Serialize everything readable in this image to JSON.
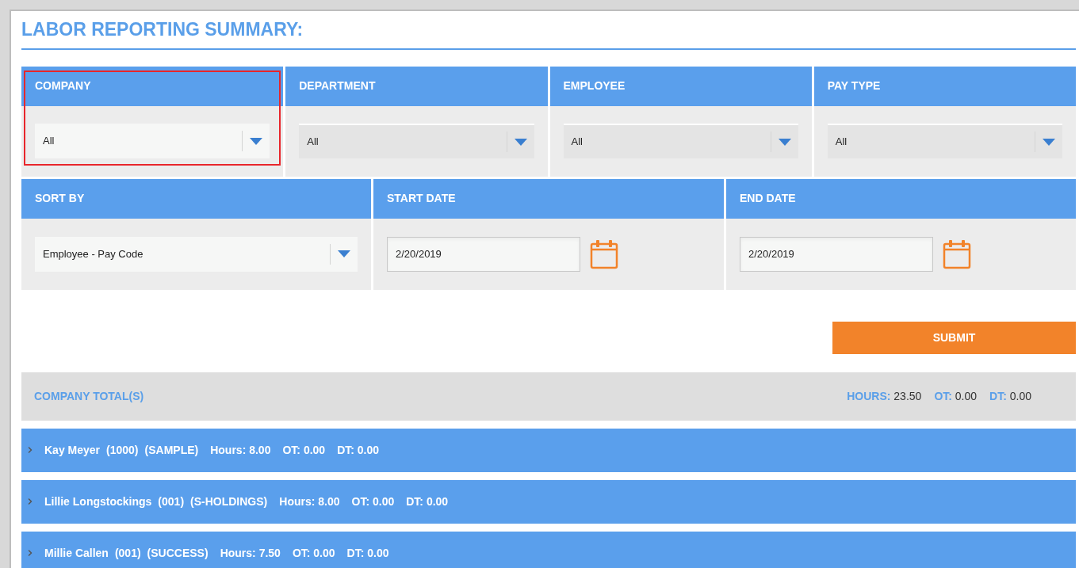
{
  "title": "LABOR REPORTING SUMMARY:",
  "filters": [
    {
      "label": "COMPANY",
      "value": "All",
      "highlighted": true
    },
    {
      "label": "DEPARTMENT",
      "value": "All",
      "highlighted": false
    },
    {
      "label": "EMPLOYEE",
      "value": "All",
      "highlighted": false
    },
    {
      "label": "PAY TYPE",
      "value": "All",
      "highlighted": false
    }
  ],
  "sort_by": {
    "label": "SORT BY",
    "value": "Employee - Pay Code"
  },
  "dates": [
    {
      "label": "START DATE",
      "value": "2/20/2019"
    },
    {
      "label": "END DATE",
      "value": "2/20/2019"
    }
  ],
  "submit": "SUBMIT",
  "company_totals": {
    "label": "COMPANY TOTAL(S)",
    "stats": [
      {
        "label": "HOURS:",
        "value": "23.50"
      },
      {
        "label": "OT:",
        "value": "0.00"
      },
      {
        "label": "DT:",
        "value": "0.00"
      }
    ]
  },
  "employees": [
    {
      "expanded": false,
      "name": "Kay Meyer",
      "code": "(1000)",
      "company": "(SAMPLE)",
      "stats": [
        "Hours: 8.00",
        "OT: 0.00",
        "DT: 0.00"
      ]
    },
    {
      "expanded": false,
      "name": "Lillie Longstockings",
      "code": "(001)",
      "company": "(S-HOLDINGS)",
      "stats": [
        "Hours: 8.00",
        "OT: 0.00",
        "DT: 0.00"
      ]
    },
    {
      "expanded": false,
      "name": "Millie Callen",
      "code": "(001)",
      "company": "(SUCCESS)",
      "stats": [
        "Hours: 7.50",
        "OT: 0.00",
        "DT: 0.00"
      ]
    }
  ]
}
